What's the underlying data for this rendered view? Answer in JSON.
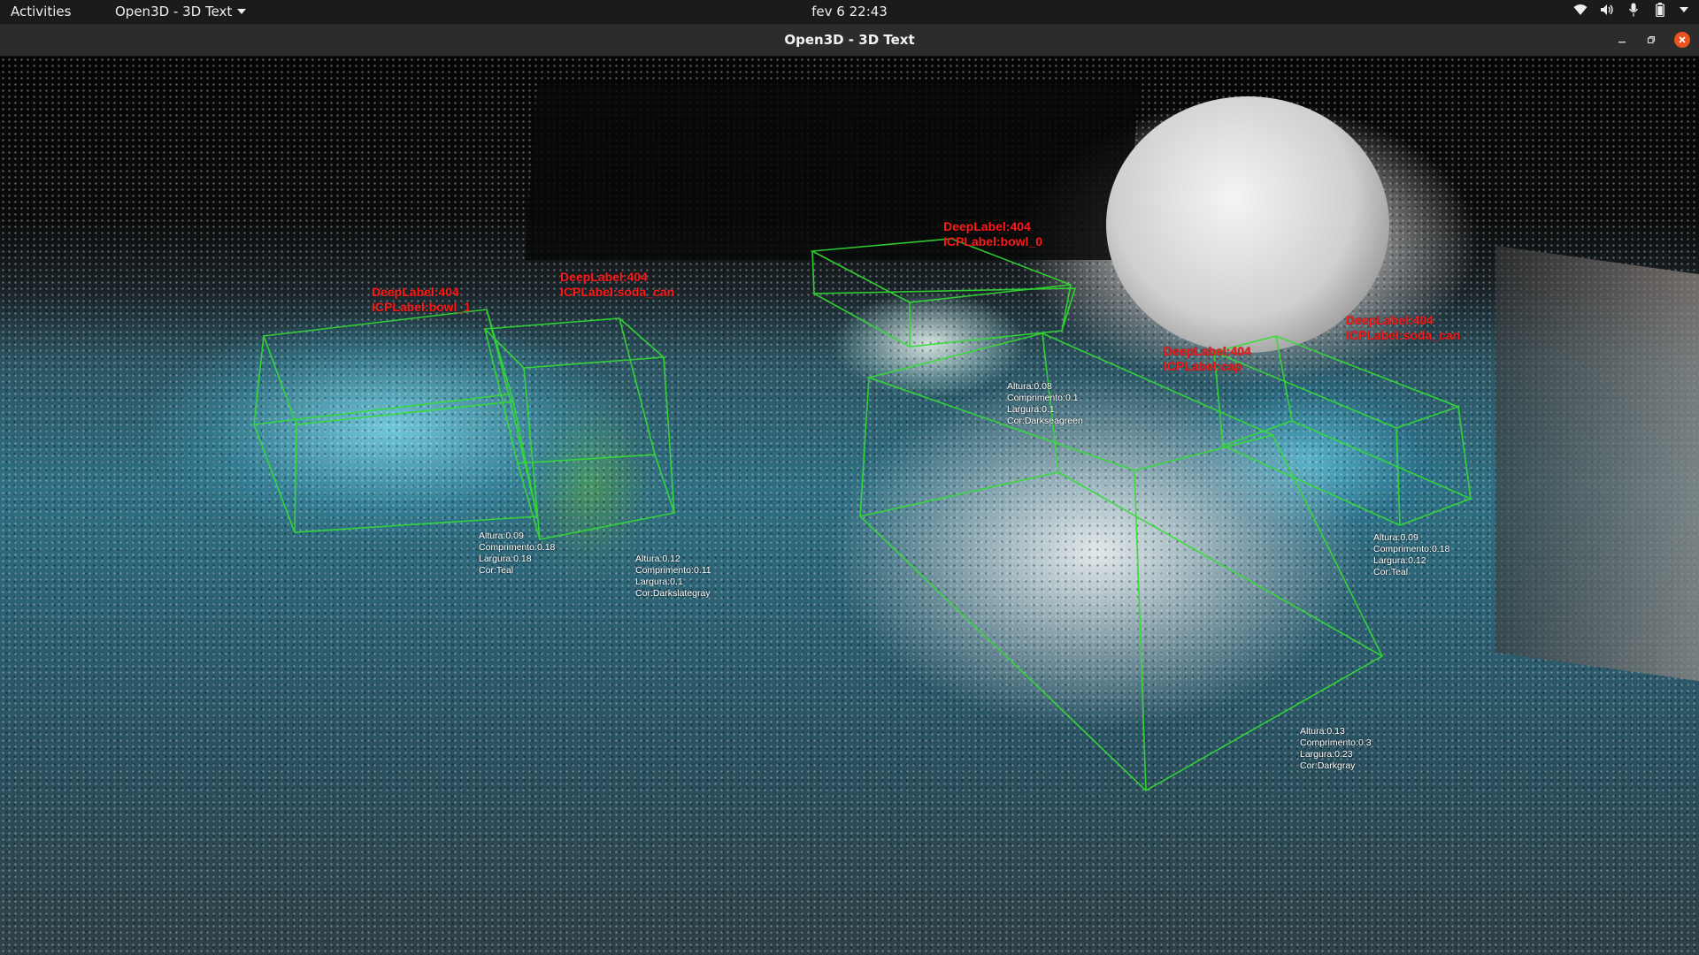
{
  "topbar": {
    "activities": "Activities",
    "app_menu": "Open3D - 3D Text",
    "clock": "fev 6  22:43",
    "tray_icons": [
      "wifi-icon",
      "volume-icon",
      "microphone-icon",
      "battery-icon",
      "chevron-down-icon"
    ]
  },
  "window": {
    "title": "Open3D - 3D Text",
    "controls": [
      "minimize",
      "maximize",
      "close"
    ]
  },
  "colors": {
    "label_red": "#ff1a1a",
    "box_green": "#33dd33",
    "close_orange": "#e95420"
  },
  "objects": [
    {
      "deep": "DeepLabel:404",
      "icp": "ICPLabel:bowl_1",
      "dims": [
        "Altura:0.09",
        "Comprimento:0.18",
        "Largura:0.18",
        "Cor:Teal"
      ]
    },
    {
      "deep": "DeepLabel:404",
      "icp": "ICPLabel:soda_can",
      "dims": [
        "Altura:0.12",
        "Comprimento:0.11",
        "Largura:0.1",
        "Cor:Darkslategray"
      ]
    },
    {
      "deep": "DeepLabel:404",
      "icp": "ICPLabel:bowl_0",
      "dims": [
        "Altura:0.08",
        "Comprimento:0.1",
        "Largura:0.1",
        "Cor:Darkseagreen"
      ]
    },
    {
      "deep": "DeepLabel:404",
      "icp": "ICPLabel:cap",
      "dims": [
        "Altura:0.13",
        "Comprimento:0.3",
        "Largura:0.23",
        "Cor:Darkgray"
      ]
    },
    {
      "deep": "DeepLabel:404",
      "icp": "ICPLabel:soda_can",
      "dims": [
        "Altura:0.09",
        "Comprimento:0.18",
        "Largura:0.12",
        "Cor:Teal"
      ]
    }
  ]
}
